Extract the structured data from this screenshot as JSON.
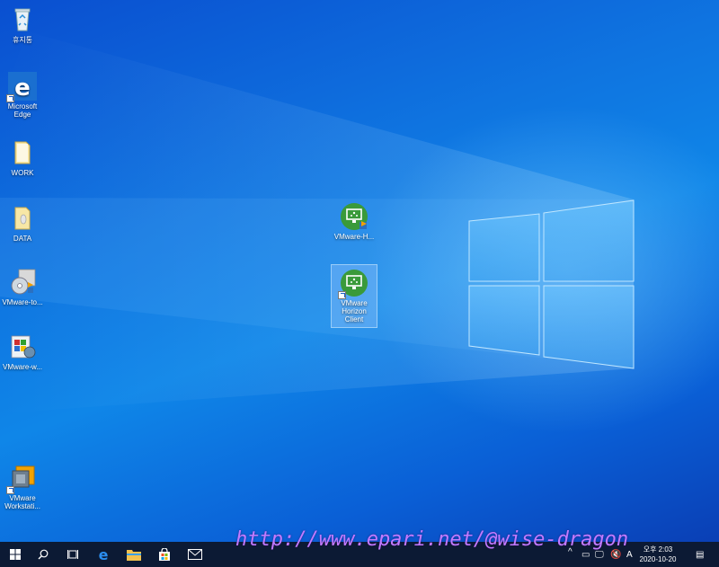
{
  "desktop_icons": {
    "recycle_bin": "휴지통",
    "edge": "Microsoft Edge",
    "work": "WORK",
    "data": "DATA",
    "vmware_tools": "VMware-to...",
    "vmware_w": "VMware-w...",
    "vmware_workstation": "VMware Workstati...",
    "vmware_h": "VMware-H...",
    "vmware_horizon_client": "VMware Horizon Client"
  },
  "tray": {
    "time": "오후 2:03",
    "date": "2020-10-20",
    "ime": "A",
    "chevron": "^"
  },
  "watermark": "http://www.epari.net/@wise-dragon",
  "colors": {
    "taskbar": "#0c1a34",
    "desktop_blue": "#0f74e0",
    "horizon_green": "#3a9a3a",
    "watermark": "#c27bff"
  },
  "icons": [
    "windows-start-icon",
    "search-icon",
    "task-view-icon",
    "edge-icon",
    "file-explorer-icon",
    "store-icon",
    "mail-icon"
  ]
}
